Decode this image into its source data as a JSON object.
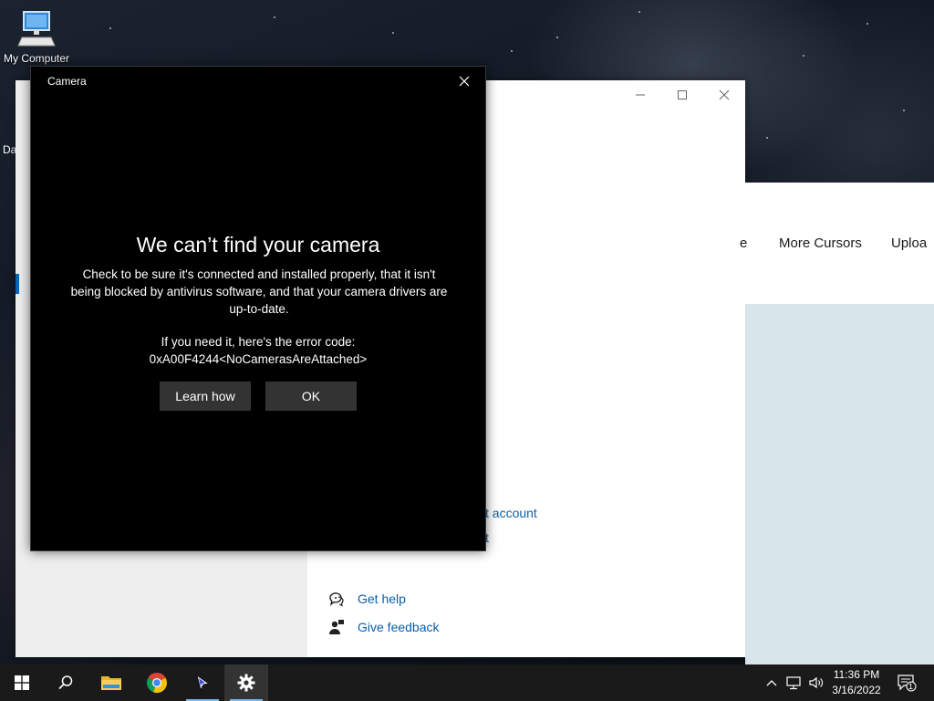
{
  "desktop": {
    "icon_label": "My Computer",
    "fragments": [
      "Da"
    ]
  },
  "camera_dialog": {
    "title": "Camera",
    "heading": "We can’t find your camera",
    "body": "Check to be sure it's connected and installed properly, that it isn't being blocked by antivirus software, and that your camera drivers are up-to-date.",
    "error_intro": "If you need it, here's the error code:",
    "error_code": "0xA00F4244<NoCamerasAreAttached>",
    "buttons": {
      "learn_how": "Learn how",
      "ok": "OK"
    }
  },
  "settings_window": {
    "link_account": "t account",
    "link_partial": "t",
    "help": {
      "get_help": "Get help",
      "give_feedback": "Give feedback"
    }
  },
  "web_page": {
    "nav_items": [
      "e",
      "More Cursors",
      "Uploa"
    ]
  },
  "taskbar": {
    "icons": [
      "start-icon",
      "search-icon",
      "file-explorer-icon",
      "chrome-icon",
      "cursor-app-icon",
      "settings-icon"
    ],
    "time": "11:36 PM",
    "date": "3/16/2022",
    "notification_count": "1"
  },
  "colors": {
    "accent": "#0067c0",
    "link": "#0a5fa8",
    "dialog_bg": "#000000",
    "button_bg": "#333333"
  }
}
